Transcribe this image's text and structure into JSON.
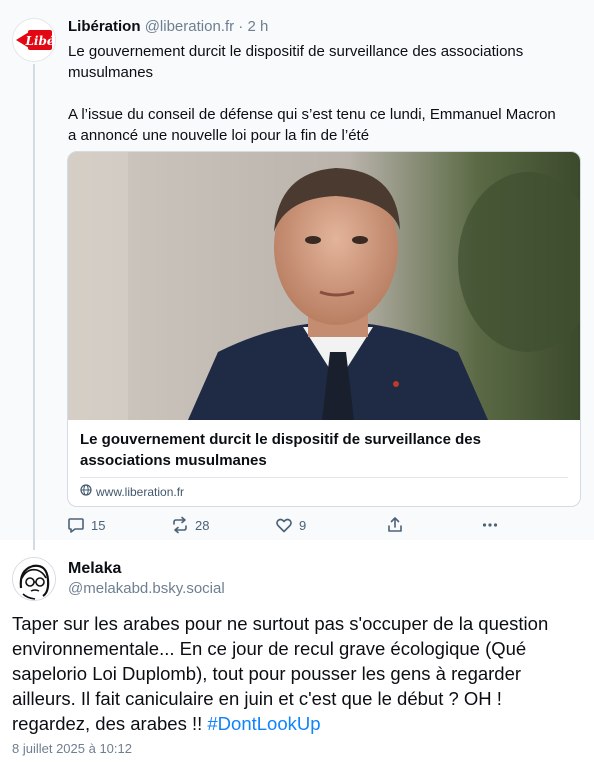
{
  "parent_post": {
    "author_name": "Libération",
    "author_handle": "@liberation.fr",
    "separator": "·",
    "time_ago": "2 h",
    "avatar_label": "Libé",
    "text_paragraphs": [
      "Le gouvernement durcit le dispositif de surveillance des associations musulmanes",
      "A l’issue du conseil de défense qui s’est tenu ce lundi, Emmanuel Macron a annoncé une nouvelle loi pour la fin de l’été"
    ],
    "link_card": {
      "title": "Le gouvernement durcit le dispositif de surveillance des associations musulmanes",
      "domain": "www.liberation.fr",
      "domain_icon": "globe-icon"
    },
    "actions": {
      "replies": "15",
      "reposts": "28",
      "likes": "9"
    }
  },
  "reply_post": {
    "author_name": "Melaka",
    "author_handle": "@melakabd.bsky.social",
    "text": "Taper sur les arabes pour ne surtout pas s'occuper de la question environnementale... En ce jour de recul grave écologique (Qué sapelorio Loi Duplomb), tout pour pousser les gens à regarder ailleurs. Il fait caniculaire en juin et c'est que le début ? OH ! regardez, des arabes !! ",
    "hashtag": "#DontLookUp",
    "timestamp": "8 juillet 2025 à 10:12"
  },
  "colors": {
    "accent_link": "#1083fe",
    "muted_text": "#6f7f91",
    "action_icon": "#4b6278",
    "liberation_red": "#e30613"
  }
}
